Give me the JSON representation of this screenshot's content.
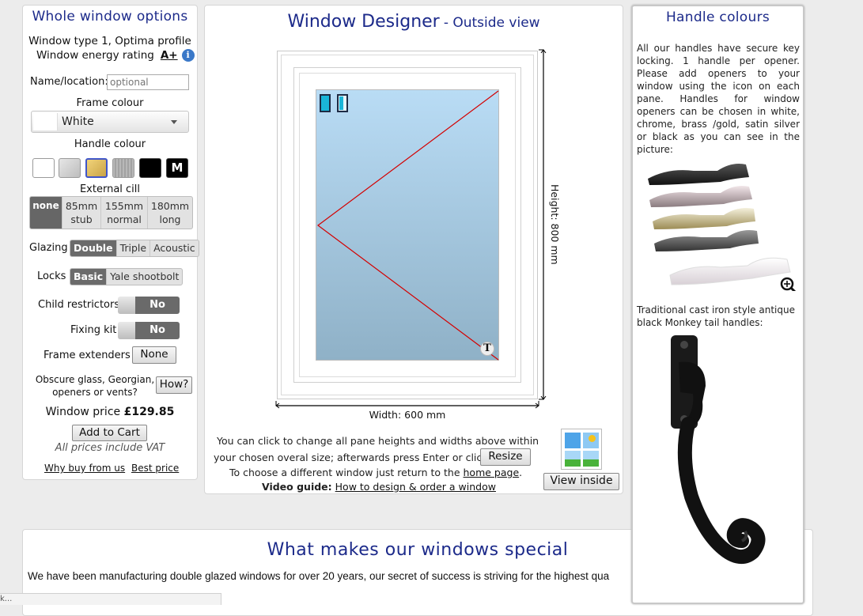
{
  "left": {
    "title": "Whole window options",
    "window_type": "Window type 1, Optima profile",
    "energy_label": "Window energy rating",
    "energy_rating": "A+",
    "name_label": "Name/location:",
    "name_placeholder": "optional",
    "frame_colour_label": "Frame colour",
    "frame_colour_value": "White",
    "handle_colour_label": "Handle colour",
    "handle_swatch_m": "M",
    "external_cill_label": "External cill",
    "cill_options": [
      {
        "top": "none",
        "bottom": ""
      },
      {
        "top": "85mm",
        "bottom": "stub"
      },
      {
        "top": "155mm",
        "bottom": "normal"
      },
      {
        "top": "180mm",
        "bottom": "long"
      }
    ],
    "glazing_label": "Glazing",
    "glazing_options": [
      "Double",
      "Triple",
      "Acoustic"
    ],
    "locks_label": "Locks",
    "locks_options": [
      "Basic",
      "Yale shootbolt"
    ],
    "child_label": "Child restrictors",
    "child_value": "No",
    "fixing_label": "Fixing kit",
    "fixing_value": "No",
    "extenders_label": "Frame extenders",
    "extenders_value": "None",
    "obscure_line1": "Obscure glass, Georgian,",
    "obscure_line2": "openers or vents?",
    "how_button": "How?",
    "price_label": "Window price",
    "price_value": "£129.85",
    "add_to_cart": "Add to Cart",
    "vat_note": "All prices include VAT",
    "why_link": "Why buy from us",
    "best_link": "Best price"
  },
  "designer": {
    "title": "Window Designer",
    "subtitle": "- Outside view",
    "height_label": "Height: 800 mm",
    "width_label": "Width: 600 mm",
    "t_marker": "T",
    "info_line1": "You can click to change all pane heights and widths above within",
    "info_line2": "your chosen overal size; afterwards press Enter or click",
    "resize_button": "Resize",
    "info_line3_pre": "To choose a different window just return to the",
    "home_link": "home page",
    "info_line3_post": ".",
    "video_label": "Video guide:",
    "video_link": "How to design & order a window",
    "view_inside": "View inside"
  },
  "right": {
    "title": "Handle colours",
    "desc": "All our handles have secure key locking. 1 handle per opener. Please add openers to your window using the icon on each pane. Handles for window openers can be chosen in white, chrome, brass /gold, satin silver or black as you can see in the picture:",
    "caption2": "Traditional cast iron style antique black Monkey tail handles:"
  },
  "bottom": {
    "title": "What makes our windows special",
    "text": "We have been manufacturing double glazed windows for over 20 years, our secret of success is striving for the highest qua"
  },
  "colors": {
    "title_blue": "#1c2a8a",
    "glass_top": "#b9dcf5",
    "glass_bottom": "#8fb1c7",
    "opening_line": "#d40000"
  }
}
